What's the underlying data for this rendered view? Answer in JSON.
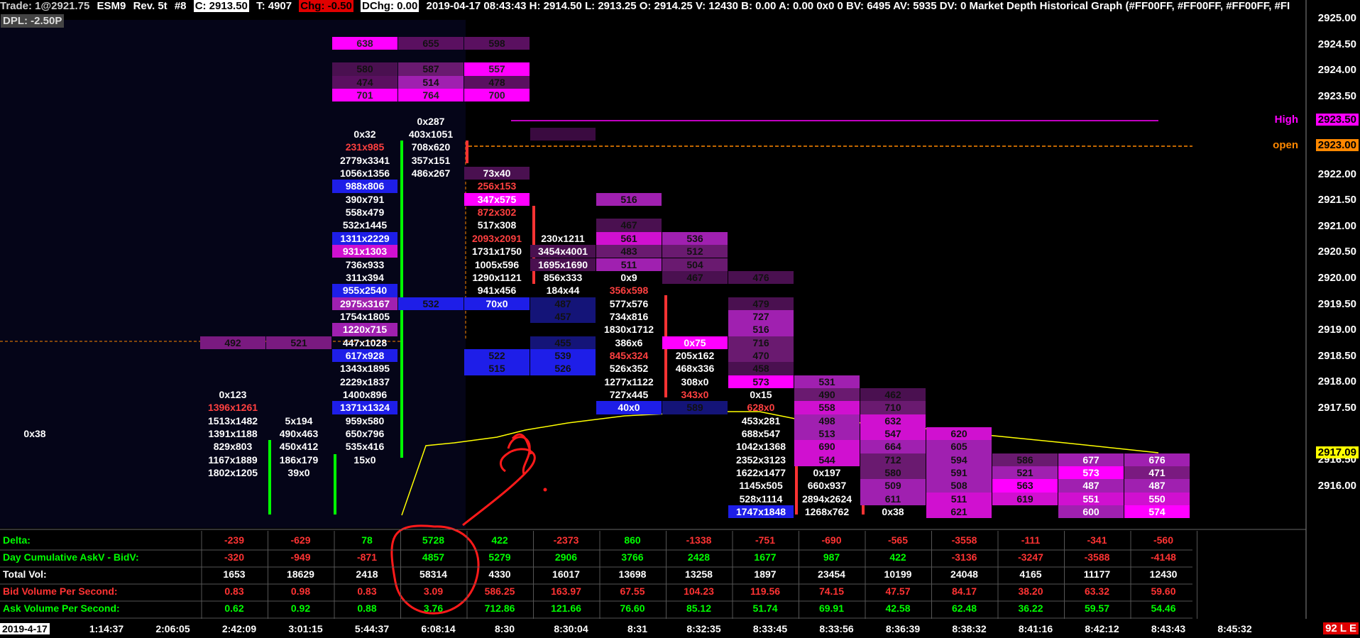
{
  "header": {
    "trade": "Trade: 1@2921.75",
    "symbol": "ESM9",
    "rev": "Rev. 5t",
    "num": "#8",
    "c": "C: 2913.50",
    "t": "T: 4907",
    "chg": "Chg: -0.50",
    "dchg": "DChg: 0.00",
    "rest": "2019-04-17  08:43:43  H: 2914.50  L: 2913.25  O: 2914.25  V: 12430  B: 0.00  A: 0.00  0x0  0  BV: 6495  AV: 5935  DV: 0  Market Depth Historical Graph    (#FF00FF, #FF00FF, #FF00FF, #FI",
    "dpl": "DPL: -2.50P"
  },
  "price_axis": {
    "labels": [
      "2925.00",
      "2924.50",
      "2924.00",
      "2923.50",
      "2923.00",
      "2922.50",
      "2922.00",
      "2921.50",
      "2921.00",
      "2920.50",
      "2920.00",
      "2919.50",
      "2919.00",
      "2918.50",
      "2918.00",
      "2917.50",
      "2917.09",
      "2916.50",
      "2916.00"
    ],
    "high_label": "High",
    "high_price": "2923.50",
    "open_label": "open",
    "open_price": "2923.00",
    "current_price": "2917.09"
  },
  "time_axis": {
    "labels": [
      "2019-4-17",
      "1:14:37",
      "2:06:05",
      "2:42:09",
      "3:01:15",
      "5:44:37",
      "6:08:14",
      "8:30",
      "8:30:04",
      "8:31",
      "8:32:35",
      "8:33:45",
      "8:33:56",
      "8:36:39",
      "8:38:32",
      "8:41:16",
      "8:42:12",
      "8:43:43",
      "8:45:32"
    ],
    "corner": "92 L E"
  },
  "colors": {
    "bull": "#00ff00",
    "bear": "#ff3333",
    "magenta": "#ff00ff",
    "blue": "#1e1ee8",
    "purple": "#800080",
    "orange": "#ff8800",
    "yellow": "#ffff00"
  },
  "stats": {
    "rows": [
      {
        "label": "Delta:",
        "color": "#00ff00",
        "values": [
          "-239",
          "-629",
          "78",
          "5728",
          "422",
          "-2373",
          "860",
          "-1338",
          "-751",
          "-690",
          "-565",
          "-3558",
          "-111",
          "-341",
          "-560"
        ]
      },
      {
        "label": "Day Cumulative AskV - BidV:",
        "color": "#00ff00",
        "values": [
          "-320",
          "-949",
          "-871",
          "4857",
          "5279",
          "2906",
          "3766",
          "2428",
          "1677",
          "987",
          "422",
          "-3136",
          "-3247",
          "-3588",
          "-4148"
        ]
      },
      {
        "label": "Total Vol:",
        "color": "#ffffff",
        "values": [
          "1653",
          "18629",
          "2418",
          "58314",
          "4330",
          "16017",
          "13698",
          "13258",
          "1897",
          "23454",
          "10199",
          "24048",
          "4165",
          "11177",
          "12430"
        ]
      },
      {
        "label": "Bid Volume Per Second:",
        "color": "#ff3333",
        "values": [
          "0.83",
          "0.98",
          "0.83",
          "3.09",
          "586.25",
          "163.97",
          "67.55",
          "104.23",
          "119.56",
          "74.15",
          "47.57",
          "84.17",
          "38.20",
          "63.32",
          "59.60"
        ]
      },
      {
        "label": "Ask Volume Per Second:",
        "color": "#00ff00",
        "values": [
          "0.62",
          "0.92",
          "0.88",
          "3.76",
          "712.86",
          "121.66",
          "76.60",
          "85.12",
          "51.74",
          "69.91",
          "42.58",
          "62.48",
          "36.22",
          "59.57",
          "54.46"
        ]
      }
    ]
  },
  "annotation": {
    "mark": "?"
  },
  "cells": [
    {
      "c": 1,
      "r": 23,
      "t": "0x38"
    },
    {
      "c": 4,
      "r": 16,
      "t": "492",
      "bg": "#7a1a80",
      "fg": "#111"
    },
    {
      "c": 5,
      "r": 16,
      "t": "521",
      "bg": "#7a1a80",
      "fg": "#111"
    },
    {
      "c": 4,
      "r": 20,
      "t": "0x123"
    },
    {
      "c": 4,
      "r": 21,
      "t": "1396x1261",
      "fg": "#ff4040"
    },
    {
      "c": 4,
      "r": 22,
      "t": "1513x1482"
    },
    {
      "c": 4,
      "r": 23,
      "t": "1391x1188"
    },
    {
      "c": 4,
      "r": 24,
      "t": "829x803"
    },
    {
      "c": 4,
      "r": 25,
      "t": "1167x1889"
    },
    {
      "c": 4,
      "r": 26,
      "t": "1802x1205"
    },
    {
      "c": 5,
      "r": 22,
      "t": "5x194"
    },
    {
      "c": 5,
      "r": 23,
      "t": "490x463"
    },
    {
      "c": 5,
      "r": 24,
      "t": "450x412"
    },
    {
      "c": 5,
      "r": 25,
      "t": "186x179"
    },
    {
      "c": 5,
      "r": 26,
      "t": "39x0"
    },
    {
      "c": 6,
      "r": -7,
      "t": "638",
      "bg": "#ff00ff",
      "fg": "#222"
    },
    {
      "c": 7,
      "r": -7,
      "t": "655",
      "bg": "#5a1060",
      "fg": "#111"
    },
    {
      "c": 8,
      "r": -7,
      "t": "598",
      "bg": "#5a1060",
      "fg": "#111"
    },
    {
      "c": 6,
      "r": -5,
      "t": "580",
      "bg": "#4a1050",
      "fg": "#111"
    },
    {
      "c": 7,
      "r": -5,
      "t": "587",
      "bg": "#6a1a70",
      "fg": "#111"
    },
    {
      "c": 8,
      "r": -5,
      "t": "557",
      "bg": "#ff00ff",
      "fg": "#222"
    },
    {
      "c": 6,
      "r": -4,
      "t": "474",
      "bg": "#5a1060",
      "fg": "#111"
    },
    {
      "c": 7,
      "r": -4,
      "t": "514",
      "bg": "#a020b0",
      "fg": "#111"
    },
    {
      "c": 8,
      "r": -4,
      "t": "478",
      "bg": "#5a1060",
      "fg": "#111"
    },
    {
      "c": 6,
      "r": -3,
      "t": "701",
      "bg": "#ff00ff",
      "fg": "#222"
    },
    {
      "c": 7,
      "r": -3,
      "t": "764",
      "bg": "#ff00ff",
      "fg": "#222"
    },
    {
      "c": 8,
      "r": -3,
      "t": "700",
      "bg": "#ff00ff",
      "fg": "#222"
    },
    {
      "c": 6,
      "r": 0,
      "t": "0x32"
    },
    {
      "c": 6,
      "r": 1,
      "t": "231x985",
      "fg": "#ff4040"
    },
    {
      "c": 6,
      "r": 2,
      "t": "2779x3341"
    },
    {
      "c": 6,
      "r": 3,
      "t": "1056x1356"
    },
    {
      "c": 6,
      "r": 4,
      "t": "988x806",
      "bg": "#1e1ee8"
    },
    {
      "c": 6,
      "r": 5,
      "t": "390x791"
    },
    {
      "c": 6,
      "r": 6,
      "t": "558x479"
    },
    {
      "c": 6,
      "r": 7,
      "t": "532x1445"
    },
    {
      "c": 6,
      "r": 8,
      "t": "1311x2229",
      "bg": "#1e1ee8"
    },
    {
      "c": 6,
      "r": 9,
      "t": "931x1303",
      "bg": "#d010d0"
    },
    {
      "c": 6,
      "r": 10,
      "t": "736x933"
    },
    {
      "c": 6,
      "r": 11,
      "t": "311x394"
    },
    {
      "c": 6,
      "r": 12,
      "t": "955x2540",
      "bg": "#1e1ee8"
    },
    {
      "c": 6,
      "r": 13,
      "t": "2975x3167",
      "bg": "#a020b0"
    },
    {
      "c": 6,
      "r": 14,
      "t": "1754x1805"
    },
    {
      "c": 6,
      "r": 15,
      "t": "1220x715",
      "bg": "#a020b0"
    },
    {
      "c": 6,
      "r": 16,
      "t": "447x1028"
    },
    {
      "c": 6,
      "r": 17,
      "t": "617x928",
      "bg": "#1e1ee8"
    },
    {
      "c": 6,
      "r": 18,
      "t": "1343x1895"
    },
    {
      "c": 6,
      "r": 19,
      "t": "2229x1837"
    },
    {
      "c": 6,
      "r": 20,
      "t": "1400x896"
    },
    {
      "c": 6,
      "r": 21,
      "t": "1371x1324",
      "bg": "#1e1ee8"
    },
    {
      "c": 6,
      "r": 22,
      "t": "959x580"
    },
    {
      "c": 6,
      "r": 23,
      "t": "650x796"
    },
    {
      "c": 6,
      "r": 24,
      "t": "535x416"
    },
    {
      "c": 6,
      "r": 25,
      "t": "15x0"
    },
    {
      "c": 7,
      "r": -1,
      "t": "0x287"
    },
    {
      "c": 7,
      "r": 0,
      "t": "403x1051"
    },
    {
      "c": 7,
      "r": 1,
      "t": "708x620"
    },
    {
      "c": 7,
      "r": 2,
      "t": "357x151"
    },
    {
      "c": 7,
      "r": 3,
      "t": "486x267"
    },
    {
      "c": 7,
      "r": 13,
      "t": "532",
      "bg": "#1e1ee8",
      "fg": "#111"
    },
    {
      "c": 8,
      "r": 3,
      "t": "73x40",
      "bg": "#4a1050"
    },
    {
      "c": 8,
      "r": 4,
      "t": "256x153",
      "fg": "#ff4040"
    },
    {
      "c": 8,
      "r": 5,
      "t": "347x575",
      "bg": "#ff00ff"
    },
    {
      "c": 8,
      "r": 6,
      "t": "872x302",
      "fg": "#ff4040"
    },
    {
      "c": 8,
      "r": 7,
      "t": "517x308"
    },
    {
      "c": 8,
      "r": 8,
      "t": "2093x2091",
      "fg": "#ff4040"
    },
    {
      "c": 8,
      "r": 9,
      "t": "1731x1750"
    },
    {
      "c": 8,
      "r": 10,
      "t": "1005x596"
    },
    {
      "c": 8,
      "r": 11,
      "t": "1290x1121"
    },
    {
      "c": 8,
      "r": 12,
      "t": "941x456"
    },
    {
      "c": 8,
      "r": 13,
      "t": "70x0",
      "bg": "#1e1ee8"
    },
    {
      "c": 8,
      "r": 17,
      "t": "522",
      "bg": "#1e1ee8",
      "fg": "#111"
    },
    {
      "c": 8,
      "r": 18,
      "t": "515",
      "bg": "#1e1ee8",
      "fg": "#111"
    },
    {
      "c": 9,
      "r": 0,
      "t": "",
      "bg": "#3a0a40"
    },
    {
      "c": 9,
      "r": 8,
      "t": "230x1211"
    },
    {
      "c": 9,
      "r": 9,
      "t": "3454x4001",
      "bg": "#4a1050"
    },
    {
      "c": 9,
      "r": 10,
      "t": "1695x1690",
      "bg": "#4a1050"
    },
    {
      "c": 9,
      "r": 11,
      "t": "856x333"
    },
    {
      "c": 9,
      "r": 12,
      "t": "184x44"
    },
    {
      "c": 9,
      "r": 13,
      "t": "487",
      "bg": "#141478",
      "fg": "#111"
    },
    {
      "c": 9,
      "r": 14,
      "t": "457",
      "bg": "#141478",
      "fg": "#111"
    },
    {
      "c": 9,
      "r": 16,
      "t": "455",
      "bg": "#141478",
      "fg": "#111"
    },
    {
      "c": 9,
      "r": 17,
      "t": "539",
      "bg": "#1e1ee8",
      "fg": "#111"
    },
    {
      "c": 9,
      "r": 18,
      "t": "526",
      "bg": "#1e1ee8",
      "fg": "#111"
    },
    {
      "c": 10,
      "r": 5,
      "t": "516",
      "bg": "#a020b0",
      "fg": "#111"
    },
    {
      "c": 10,
      "r": 7,
      "t": "467",
      "bg": "#4a1050",
      "fg": "#111"
    },
    {
      "c": 10,
      "r": 8,
      "t": "561",
      "bg": "#d010d0",
      "fg": "#111"
    },
    {
      "c": 10,
      "r": 9,
      "t": "483",
      "bg": "#6a1a70",
      "fg": "#111"
    },
    {
      "c": 10,
      "r": 10,
      "t": "511",
      "bg": "#a020b0",
      "fg": "#111"
    },
    {
      "c": 10,
      "r": 11,
      "t": "0x9"
    },
    {
      "c": 10,
      "r": 12,
      "t": "356x598",
      "fg": "#ff4040"
    },
    {
      "c": 10,
      "r": 13,
      "t": "577x576"
    },
    {
      "c": 10,
      "r": 14,
      "t": "734x816"
    },
    {
      "c": 10,
      "r": 15,
      "t": "1830x1712"
    },
    {
      "c": 10,
      "r": 16,
      "t": "386x6"
    },
    {
      "c": 10,
      "r": 17,
      "t": "845x324",
      "fg": "#ff4040"
    },
    {
      "c": 10,
      "r": 18,
      "t": "526x352"
    },
    {
      "c": 10,
      "r": 19,
      "t": "1277x1122"
    },
    {
      "c": 10,
      "r": 20,
      "t": "727x445"
    },
    {
      "c": 10,
      "r": 21,
      "t": "40x0",
      "bg": "#1e1ee8"
    },
    {
      "c": 11,
      "r": 8,
      "t": "536",
      "bg": "#a020b0",
      "fg": "#111"
    },
    {
      "c": 11,
      "r": 9,
      "t": "512",
      "bg": "#6a1a70",
      "fg": "#111"
    },
    {
      "c": 11,
      "r": 10,
      "t": "504",
      "bg": "#6a1a70",
      "fg": "#111"
    },
    {
      "c": 11,
      "r": 11,
      "t": "467",
      "bg": "#4a1050",
      "fg": "#111"
    },
    {
      "c": 11,
      "r": 16,
      "t": "0x75",
      "bg": "#ff00ff"
    },
    {
      "c": 11,
      "r": 17,
      "t": "205x162"
    },
    {
      "c": 11,
      "r": 18,
      "t": "468x336"
    },
    {
      "c": 11,
      "r": 19,
      "t": "308x0"
    },
    {
      "c": 11,
      "r": 20,
      "t": "343x0",
      "fg": "#ff4040"
    },
    {
      "c": 11,
      "r": 21,
      "t": "589",
      "bg": "#141478",
      "fg": "#111"
    },
    {
      "c": 12,
      "r": 11,
      "t": "476",
      "bg": "#4a1050",
      "fg": "#111"
    },
    {
      "c": 12,
      "r": 13,
      "t": "479",
      "bg": "#4a1050",
      "fg": "#111"
    },
    {
      "c": 12,
      "r": 14,
      "t": "727",
      "bg": "#a020b0",
      "fg": "#111"
    },
    {
      "c": 12,
      "r": 15,
      "t": "516",
      "bg": "#a020b0",
      "fg": "#111"
    },
    {
      "c": 12,
      "r": 16,
      "t": "716",
      "bg": "#6a1a70",
      "fg": "#111"
    },
    {
      "c": 12,
      "r": 17,
      "t": "470",
      "bg": "#6a1a70",
      "fg": "#111"
    },
    {
      "c": 12,
      "r": 18,
      "t": "458",
      "bg": "#4a1050",
      "fg": "#111"
    },
    {
      "c": 12,
      "r": 19,
      "t": "573",
      "bg": "#ff00ff",
      "fg": "#111"
    },
    {
      "c": 12,
      "r": 20,
      "t": "0x15"
    },
    {
      "c": 12,
      "r": 21,
      "t": "628x0",
      "fg": "#ff4040"
    },
    {
      "c": 12,
      "r": 22,
      "t": "453x281"
    },
    {
      "c": 12,
      "r": 23,
      "t": "688x547"
    },
    {
      "c": 12,
      "r": 24,
      "t": "1042x1368"
    },
    {
      "c": 12,
      "r": 25,
      "t": "2352x3123"
    },
    {
      "c": 12,
      "r": 26,
      "t": "1622x1477"
    },
    {
      "c": 12,
      "r": 27,
      "t": "1145x505"
    },
    {
      "c": 12,
      "r": 28,
      "t": "528x1114"
    },
    {
      "c": 12,
      "r": 29,
      "t": "1747x1848",
      "bg": "#1e1ee8"
    },
    {
      "c": 13,
      "r": 19,
      "t": "531",
      "bg": "#a020b0",
      "fg": "#111"
    },
    {
      "c": 13,
      "r": 20,
      "t": "490",
      "bg": "#6a1a70",
      "fg": "#111"
    },
    {
      "c": 13,
      "r": 21,
      "t": "558",
      "bg": "#d010d0",
      "fg": "#111"
    },
    {
      "c": 13,
      "r": 22,
      "t": "498",
      "bg": "#a020b0",
      "fg": "#111"
    },
    {
      "c": 13,
      "r": 23,
      "t": "513",
      "bg": "#a020b0",
      "fg": "#111"
    },
    {
      "c": 13,
      "r": 24,
      "t": "690",
      "bg": "#d010d0",
      "fg": "#111"
    },
    {
      "c": 13,
      "r": 25,
      "t": "544",
      "bg": "#d010d0",
      "fg": "#111"
    },
    {
      "c": 13,
      "r": 26,
      "t": "0x197"
    },
    {
      "c": 13,
      "r": 27,
      "t": "660x937"
    },
    {
      "c": 13,
      "r": 28,
      "t": "2894x2624"
    },
    {
      "c": 13,
      "r": 29,
      "t": "1268x762"
    },
    {
      "c": 14,
      "r": 20,
      "t": "462",
      "bg": "#4a1050",
      "fg": "#111"
    },
    {
      "c": 14,
      "r": 21,
      "t": "710",
      "bg": "#6a1a70",
      "fg": "#111"
    },
    {
      "c": 14,
      "r": 22,
      "t": "632",
      "bg": "#d010d0",
      "fg": "#111"
    },
    {
      "c": 14,
      "r": 23,
      "t": "547",
      "bg": "#d010d0",
      "fg": "#111"
    },
    {
      "c": 14,
      "r": 24,
      "t": "664",
      "bg": "#a020b0",
      "fg": "#111"
    },
    {
      "c": 14,
      "r": 25,
      "t": "712",
      "bg": "#6a1a70",
      "fg": "#111"
    },
    {
      "c": 14,
      "r": 26,
      "t": "580",
      "bg": "#6a1a70",
      "fg": "#111"
    },
    {
      "c": 14,
      "r": 27,
      "t": "509",
      "bg": "#a020b0",
      "fg": "#111"
    },
    {
      "c": 14,
      "r": 28,
      "t": "611",
      "bg": "#a020b0",
      "fg": "#111"
    },
    {
      "c": 14,
      "r": 29,
      "t": "0x38"
    },
    {
      "c": 15,
      "r": 23,
      "t": "620",
      "bg": "#d010d0",
      "fg": "#111"
    },
    {
      "c": 15,
      "r": 24,
      "t": "605",
      "bg": "#a020b0",
      "fg": "#111"
    },
    {
      "c": 15,
      "r": 25,
      "t": "594",
      "bg": "#a020b0",
      "fg": "#111"
    },
    {
      "c": 15,
      "r": 26,
      "t": "591",
      "bg": "#a020b0",
      "fg": "#111"
    },
    {
      "c": 15,
      "r": 27,
      "t": "508",
      "bg": "#a020b0",
      "fg": "#111"
    },
    {
      "c": 15,
      "r": 28,
      "t": "511",
      "bg": "#d010d0",
      "fg": "#111"
    },
    {
      "c": 15,
      "r": 29,
      "t": "621",
      "bg": "#d010d0",
      "fg": "#111"
    },
    {
      "c": 16,
      "r": 25,
      "t": "586",
      "bg": "#6a1a70",
      "fg": "#111"
    },
    {
      "c": 16,
      "r": 26,
      "t": "521",
      "bg": "#a020b0",
      "fg": "#111"
    },
    {
      "c": 16,
      "r": 27,
      "t": "563",
      "bg": "#ff00ff",
      "fg": "#111"
    },
    {
      "c": 16,
      "r": 28,
      "t": "619",
      "bg": "#d010d0",
      "fg": "#111"
    },
    {
      "c": 17,
      "r": 25,
      "t": "677",
      "bg": "#a020b0",
      "fg": "#fff"
    },
    {
      "c": 17,
      "r": 26,
      "t": "573",
      "bg": "#ff00ff",
      "fg": "#fff"
    },
    {
      "c": 17,
      "r": 27,
      "t": "487",
      "bg": "#a020b0",
      "fg": "#fff"
    },
    {
      "c": 17,
      "r": 28,
      "t": "551",
      "bg": "#d010d0",
      "fg": "#fff"
    },
    {
      "c": 17,
      "r": 29,
      "t": "600",
      "bg": "#a020b0",
      "fg": "#fff"
    },
    {
      "c": 18,
      "r": 25,
      "t": "676",
      "bg": "#a020b0",
      "fg": "#fff"
    },
    {
      "c": 18,
      "r": 26,
      "t": "471",
      "bg": "#7a1a80",
      "fg": "#fff"
    },
    {
      "c": 18,
      "r": 27,
      "t": "487",
      "bg": "#a020b0",
      "fg": "#fff"
    },
    {
      "c": 18,
      "r": 28,
      "t": "550",
      "bg": "#d010d0",
      "fg": "#fff"
    },
    {
      "c": 18,
      "r": 29,
      "t": "574",
      "bg": "#ff00ff",
      "fg": "#fff"
    }
  ]
}
